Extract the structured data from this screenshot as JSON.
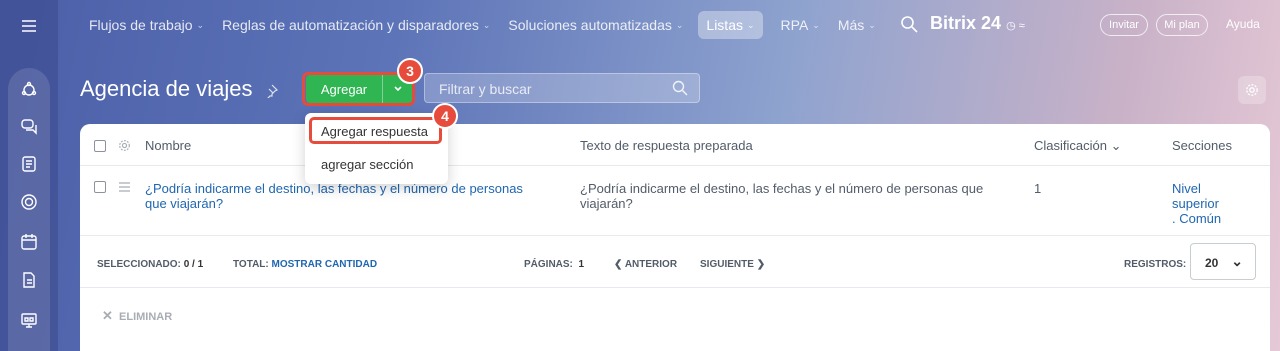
{
  "nav": {
    "items": [
      {
        "label": "Flujos de trabajo"
      },
      {
        "label": "Reglas de automatización y disparadores"
      },
      {
        "label": "Soluciones automatizadas"
      },
      {
        "label": "Listas"
      },
      {
        "label": "RPA"
      },
      {
        "label": "Más"
      }
    ],
    "brand": "Bitrix 24",
    "invite": "Invitar",
    "plan": "Mi plan",
    "help": "Ayuda"
  },
  "page": {
    "title": "Agencia de viajes",
    "add_label": "Agregar",
    "filter_placeholder": "Filtrar y buscar"
  },
  "badges": {
    "step3": "3",
    "step4": "4"
  },
  "dropdown": {
    "items": [
      "Agregar respuesta",
      "agregar sección"
    ]
  },
  "table": {
    "columns": [
      "Nombre",
      "Texto de respuesta preparada",
      "Clasificación",
      "Secciones"
    ],
    "rows": [
      {
        "name_l1": "¿Podría indicarme el destino, las fechas y el número de personas",
        "name_l2": "que viajarán?",
        "text_l1": "¿Podría indicarme el destino, las fechas y el número de personas que",
        "text_l2": "viajarán?",
        "rank": "1",
        "section_l1": "Nivel",
        "section_l2": "superior",
        "section_l3": ". Común"
      }
    ]
  },
  "footer": {
    "selected_label": "SELECCIONADO:",
    "selected_value": "0 / 1",
    "total_label": "TOTAL:",
    "total_link": "MOSTRAR CANTIDAD",
    "pages_label": "PÁGINAS:",
    "pages_value": "1",
    "prev": "ANTERIOR",
    "next": "SIGUIENTE",
    "records_label": "REGISTROS:",
    "records_value": "20",
    "delete": "ELIMINAR"
  },
  "colors": {
    "accent_green": "#2fb552",
    "highlight_red": "#e64b3b",
    "link_blue": "#2067b0"
  }
}
